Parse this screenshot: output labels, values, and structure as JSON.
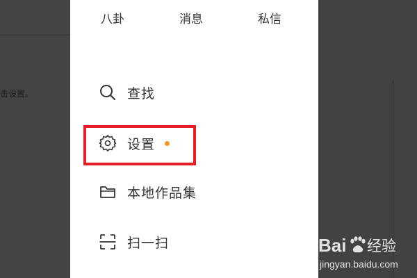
{
  "background": {
    "left_text": "击设置。"
  },
  "top_tabs": [
    {
      "label": "八卦"
    },
    {
      "label": "消息"
    },
    {
      "label": "私信"
    }
  ],
  "menu": {
    "items": [
      {
        "label": "查找",
        "icon": "search-icon"
      },
      {
        "label": "设置",
        "icon": "gear-icon",
        "has_dot": true
      },
      {
        "label": "本地作品集",
        "icon": "folder-icon"
      },
      {
        "label": "扫一扫",
        "icon": "scan-icon"
      }
    ]
  },
  "watermark": {
    "brand": "Bai",
    "word": "经验",
    "url": "jingyan.baidu.com"
  },
  "colors": {
    "highlight": "#e31e25",
    "dot": "#f4921e",
    "text": "#333333"
  }
}
